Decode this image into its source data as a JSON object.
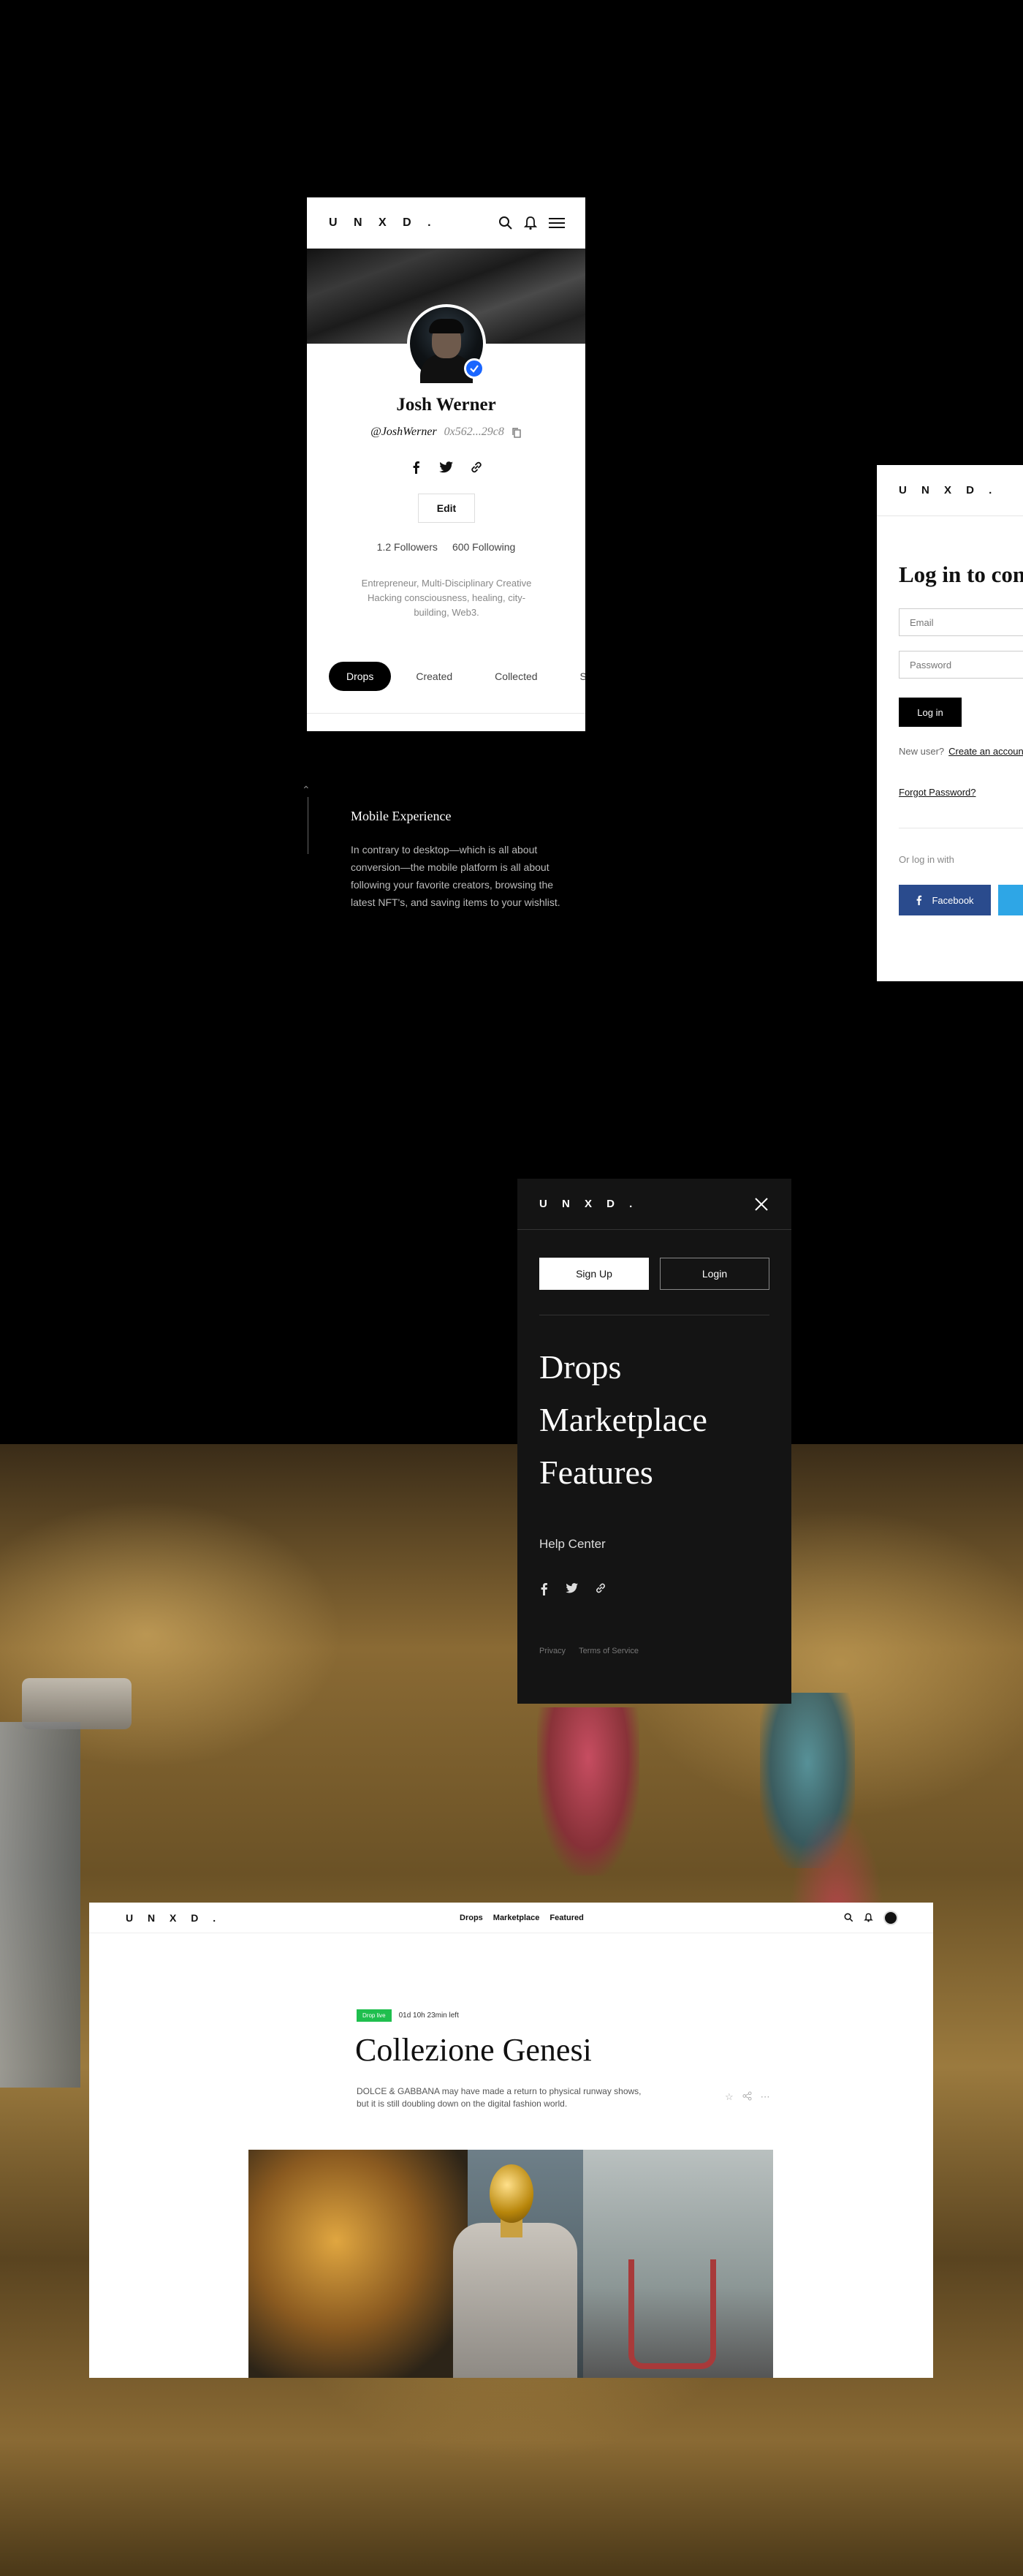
{
  "brand": {
    "logo": "U N X D ."
  },
  "profile": {
    "name": "Josh Werner",
    "handle": "@JoshWerner",
    "address": "0x562...29c8",
    "edit_label": "Edit",
    "followers": "1.2 Followers",
    "following": "600 Following",
    "bio": "Entrepreneur, Multi-Disciplinary Creative Hacking consciousness, healing, city-building, Web3.",
    "tabs": [
      "Drops",
      "Created",
      "Collected",
      "Saved"
    ]
  },
  "caption": {
    "title": "Mobile Experience",
    "text": "In contrary to desktop—which is all about conversion—the mobile platform is all about following your favorite creators, browsing the latest NFT's, and saving items to your wishlist."
  },
  "login": {
    "title": "Log in to continue",
    "email_placeholder": "Email",
    "password_placeholder": "Password",
    "login_button": "Log in",
    "new_user": "New user?",
    "create_account": "Create an account",
    "forgot": "Forgot Password?",
    "or_login_with": "Or log in with",
    "facebook": "Facebook"
  },
  "menu": {
    "signup": "Sign Up",
    "login": "Login",
    "nav": [
      "Drops",
      "Marketplace",
      "Features"
    ],
    "help": "Help Center",
    "privacy": "Privacy",
    "terms": "Terms of Service"
  },
  "desktop": {
    "nav": [
      "Drops",
      "Marketplace",
      "Featured"
    ],
    "badge": "Drop live",
    "time_left": "01d 10h 23min left",
    "title": "Collezione Genesi",
    "description": "DOLCE & GABBANA may have made a return to physical runway shows, but it is still doubling down on the digital fashion world."
  },
  "colors": {
    "verified_blue": "#1a66ff",
    "live_green": "#1fbf4e",
    "facebook_blue": "#2a4b8d",
    "twitter_blue": "#2ea6e6"
  }
}
